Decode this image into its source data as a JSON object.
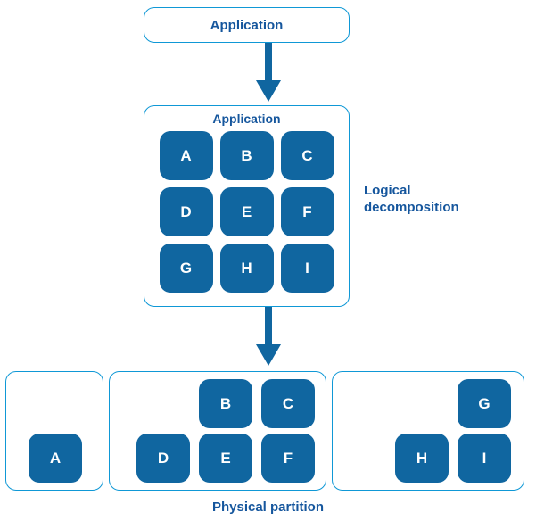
{
  "top": {
    "title": "Application"
  },
  "logical": {
    "title": "Application",
    "tiles": [
      "A",
      "B",
      "C",
      "D",
      "E",
      "F",
      "G",
      "H",
      "I"
    ]
  },
  "labels": {
    "side_line1": "Logical",
    "side_line2": "decomposition",
    "bottom": "Physical partition"
  },
  "physical": {
    "box1": {
      "A": "A"
    },
    "box2": {
      "B": "B",
      "C": "C",
      "D": "D",
      "E": "E",
      "F": "F"
    },
    "box3": {
      "G": "G",
      "H": "H",
      "I": "I"
    }
  },
  "colors": {
    "accent": "#0f98d6",
    "tile": "#1066a0",
    "text": "#15569d"
  }
}
